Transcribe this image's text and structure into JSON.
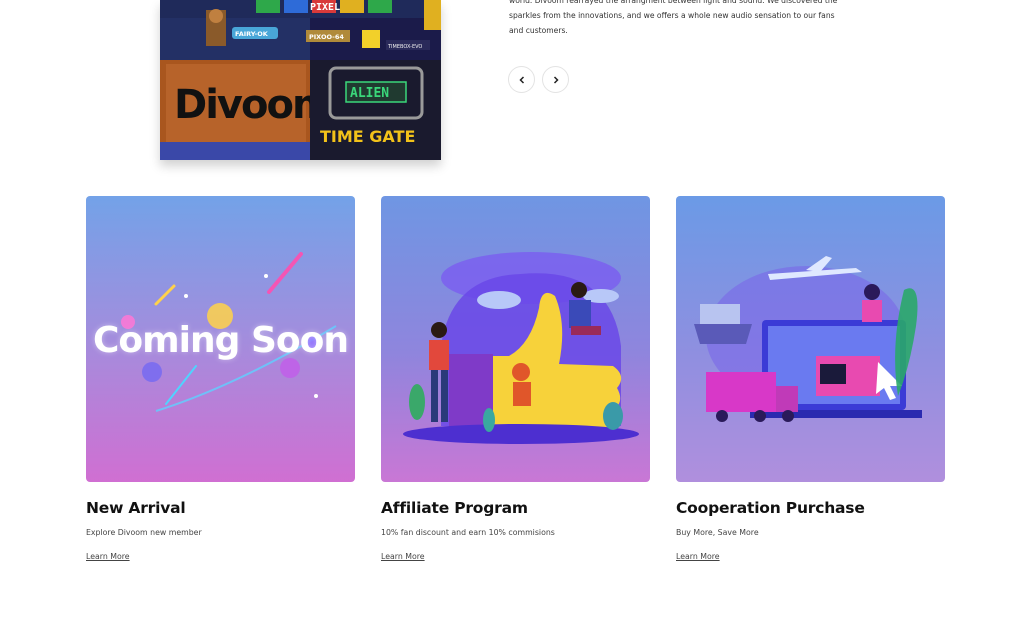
{
  "hero": {
    "text": "world. Divoom rearrayed the arrangment between light and sound. We discovered the sparkles from the innovations, and we offers a whole new audio sensation to our fans and customers.",
    "image_labels": {
      "brand": "Divoom",
      "badge1": "FAIRY-OK",
      "badge2": "PIXOO-64",
      "badge3": "TIMEBOX-EVO",
      "banner": "PIXEL",
      "game_title": "ALIEN",
      "game_subtitle": "TIME GATE"
    },
    "prev_icon": "chevron-left-icon",
    "next_icon": "chevron-right-icon"
  },
  "cards": [
    {
      "title": "New Arrival",
      "description": "Explore Divoom new member",
      "link": "Learn More",
      "image_text": "Coming Soon"
    },
    {
      "title": "Affiliate Program",
      "description": "10% fan discount and earn 10% commisions",
      "link": "Learn More"
    },
    {
      "title": "Cooperation Purchase",
      "description": "Buy More, Save More",
      "link": "Learn More"
    }
  ],
  "colors": {
    "text": "#111111",
    "pink": "#d06fd2",
    "blue": "#6f96e3"
  }
}
